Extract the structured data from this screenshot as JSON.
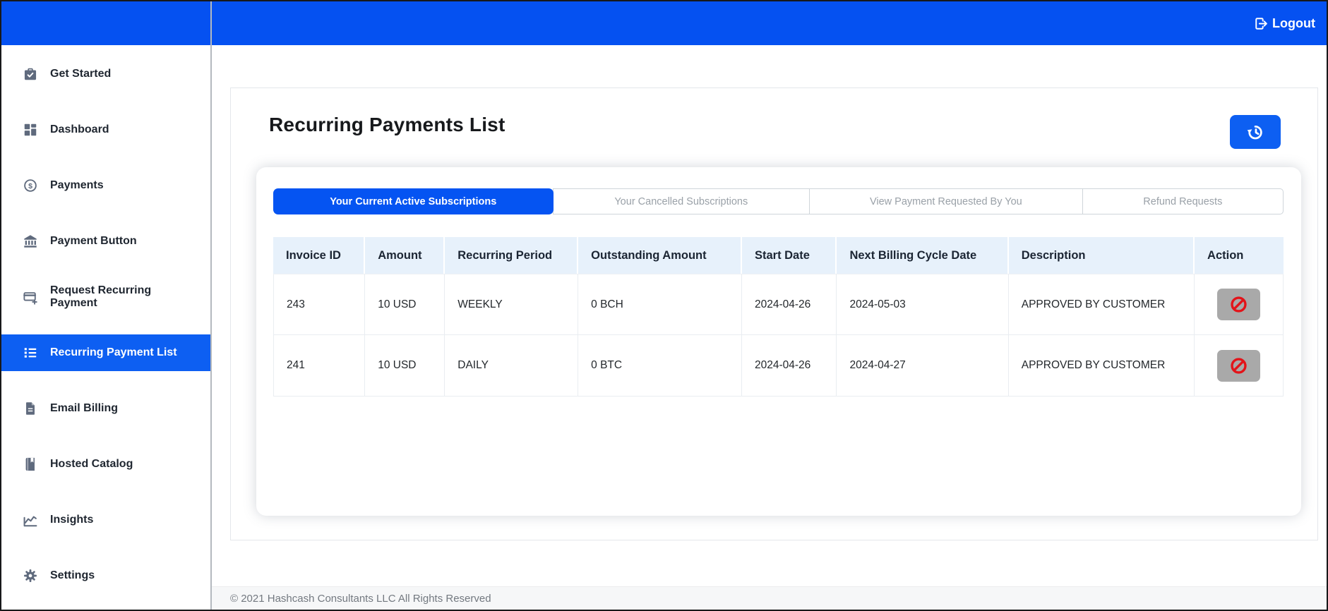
{
  "topbar": {
    "logout_label": "Logout",
    "logout_icon": "sign-out-icon"
  },
  "sidebar": {
    "items": [
      {
        "label": "Get Started",
        "icon": "briefcase-check-icon",
        "active": false
      },
      {
        "label": "Dashboard",
        "icon": "dashboard-grid-icon",
        "active": false
      },
      {
        "label": "Payments",
        "icon": "dollar-circle-icon",
        "active": false
      },
      {
        "label": "Payment Button",
        "icon": "bank-icon",
        "active": false
      },
      {
        "label": "Request Recurring Payment",
        "icon": "card-plus-icon",
        "active": false
      },
      {
        "label": "Recurring Payment List",
        "icon": "list-icon",
        "active": true
      },
      {
        "label": "Email Billing",
        "icon": "document-icon",
        "active": false
      },
      {
        "label": "Hosted Catalog",
        "icon": "book-icon",
        "active": false
      },
      {
        "label": "Insights",
        "icon": "chart-line-icon",
        "active": false
      },
      {
        "label": "Settings",
        "icon": "gear-icon",
        "active": false
      }
    ]
  },
  "main": {
    "title": "Recurring Payments List",
    "refresh_button_icon": "history-icon",
    "tabs": [
      {
        "label": "Your Current Active Subscriptions",
        "active": true
      },
      {
        "label": "Your Cancelled Subscriptions",
        "active": false
      },
      {
        "label": "View Payment Requested By You",
        "active": false
      },
      {
        "label": "Refund Requests",
        "active": false
      }
    ],
    "table": {
      "columns": [
        "Invoice ID",
        "Amount",
        "Recurring Period",
        "Outstanding Amount",
        "Start Date",
        "Next Billing Cycle Date",
        "Description",
        "Action"
      ],
      "rows": [
        {
          "invoice_id": "243",
          "amount": "10 USD",
          "recurring_period": "WEEKLY",
          "outstanding_amount": "0 BCH",
          "start_date": "2024-04-26",
          "next_billing_cycle_date": "2024-05-03",
          "description": "APPROVED BY CUSTOMER",
          "action_icon": "cancel-ban-icon"
        },
        {
          "invoice_id": "241",
          "amount": "10 USD",
          "recurring_period": "DAILY",
          "outstanding_amount": "0 BTC",
          "start_date": "2024-04-26",
          "next_billing_cycle_date": "2024-04-27",
          "description": "APPROVED BY CUSTOMER",
          "action_icon": "cancel-ban-icon"
        }
      ]
    }
  },
  "footer": {
    "copyright": "© 2021 Hashcash Consultants LLC All Rights Reserved"
  },
  "colors": {
    "header_blue": "#0551f1",
    "active_blue": "#0d5ff2",
    "tab_active_blue": "#0554f2",
    "table_header_bg": "#e7f1fb",
    "danger_red": "#e31319",
    "action_gray": "#a9a9a9"
  }
}
